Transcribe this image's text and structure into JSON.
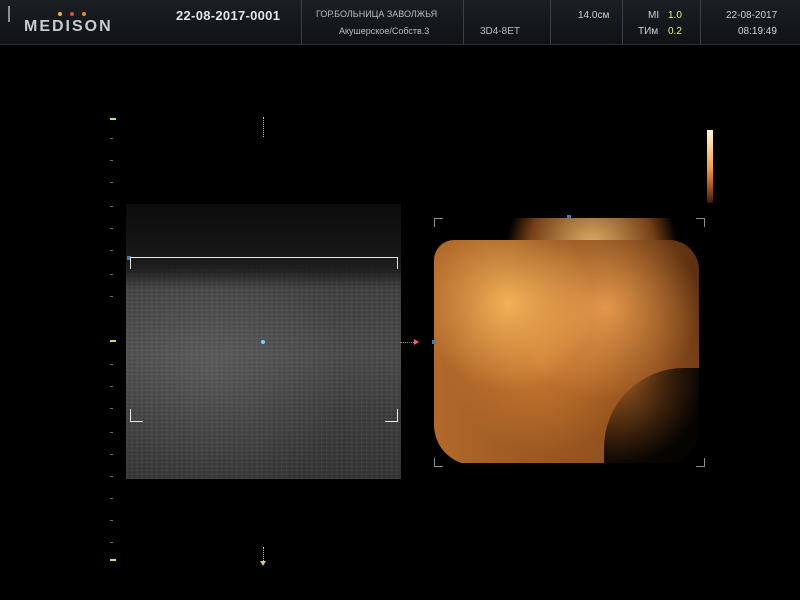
{
  "header": {
    "brand": "MEDISON",
    "brand_dot_colors": [
      "#f2b13a",
      "#e24b3b",
      "#f08a2b"
    ],
    "patient_id": "22-08-2017-0001",
    "hospital": "ГОР.БОЛЬНИЦА ЗАВОЛЖЬЯ",
    "exam_mode": "Акушерское/Собств.3",
    "probe": "3D4-8ET",
    "depth": "14.0см",
    "mi_label": "MI",
    "mi_value": "1.0",
    "ti_label": "ТИм",
    "ti_value": "0.2",
    "date": "22-08-2017",
    "time": "08:19:49"
  },
  "views": {
    "bmode": {
      "name": "2D B-mode slice"
    },
    "render3d": {
      "name": "3D surface render"
    }
  },
  "ui_icons": {
    "roi_box": "roi-bracket",
    "cursor_line": "dotted-cursor-line",
    "arrow": "arrow-icon"
  },
  "colors": {
    "accent_mi_ti": "#d7ff7a",
    "ruler_green": "#a9f56a",
    "ruler_yellow": "#d5d56a",
    "roi_white": "#e6e6e6",
    "render_orange": "#b36a2b"
  }
}
